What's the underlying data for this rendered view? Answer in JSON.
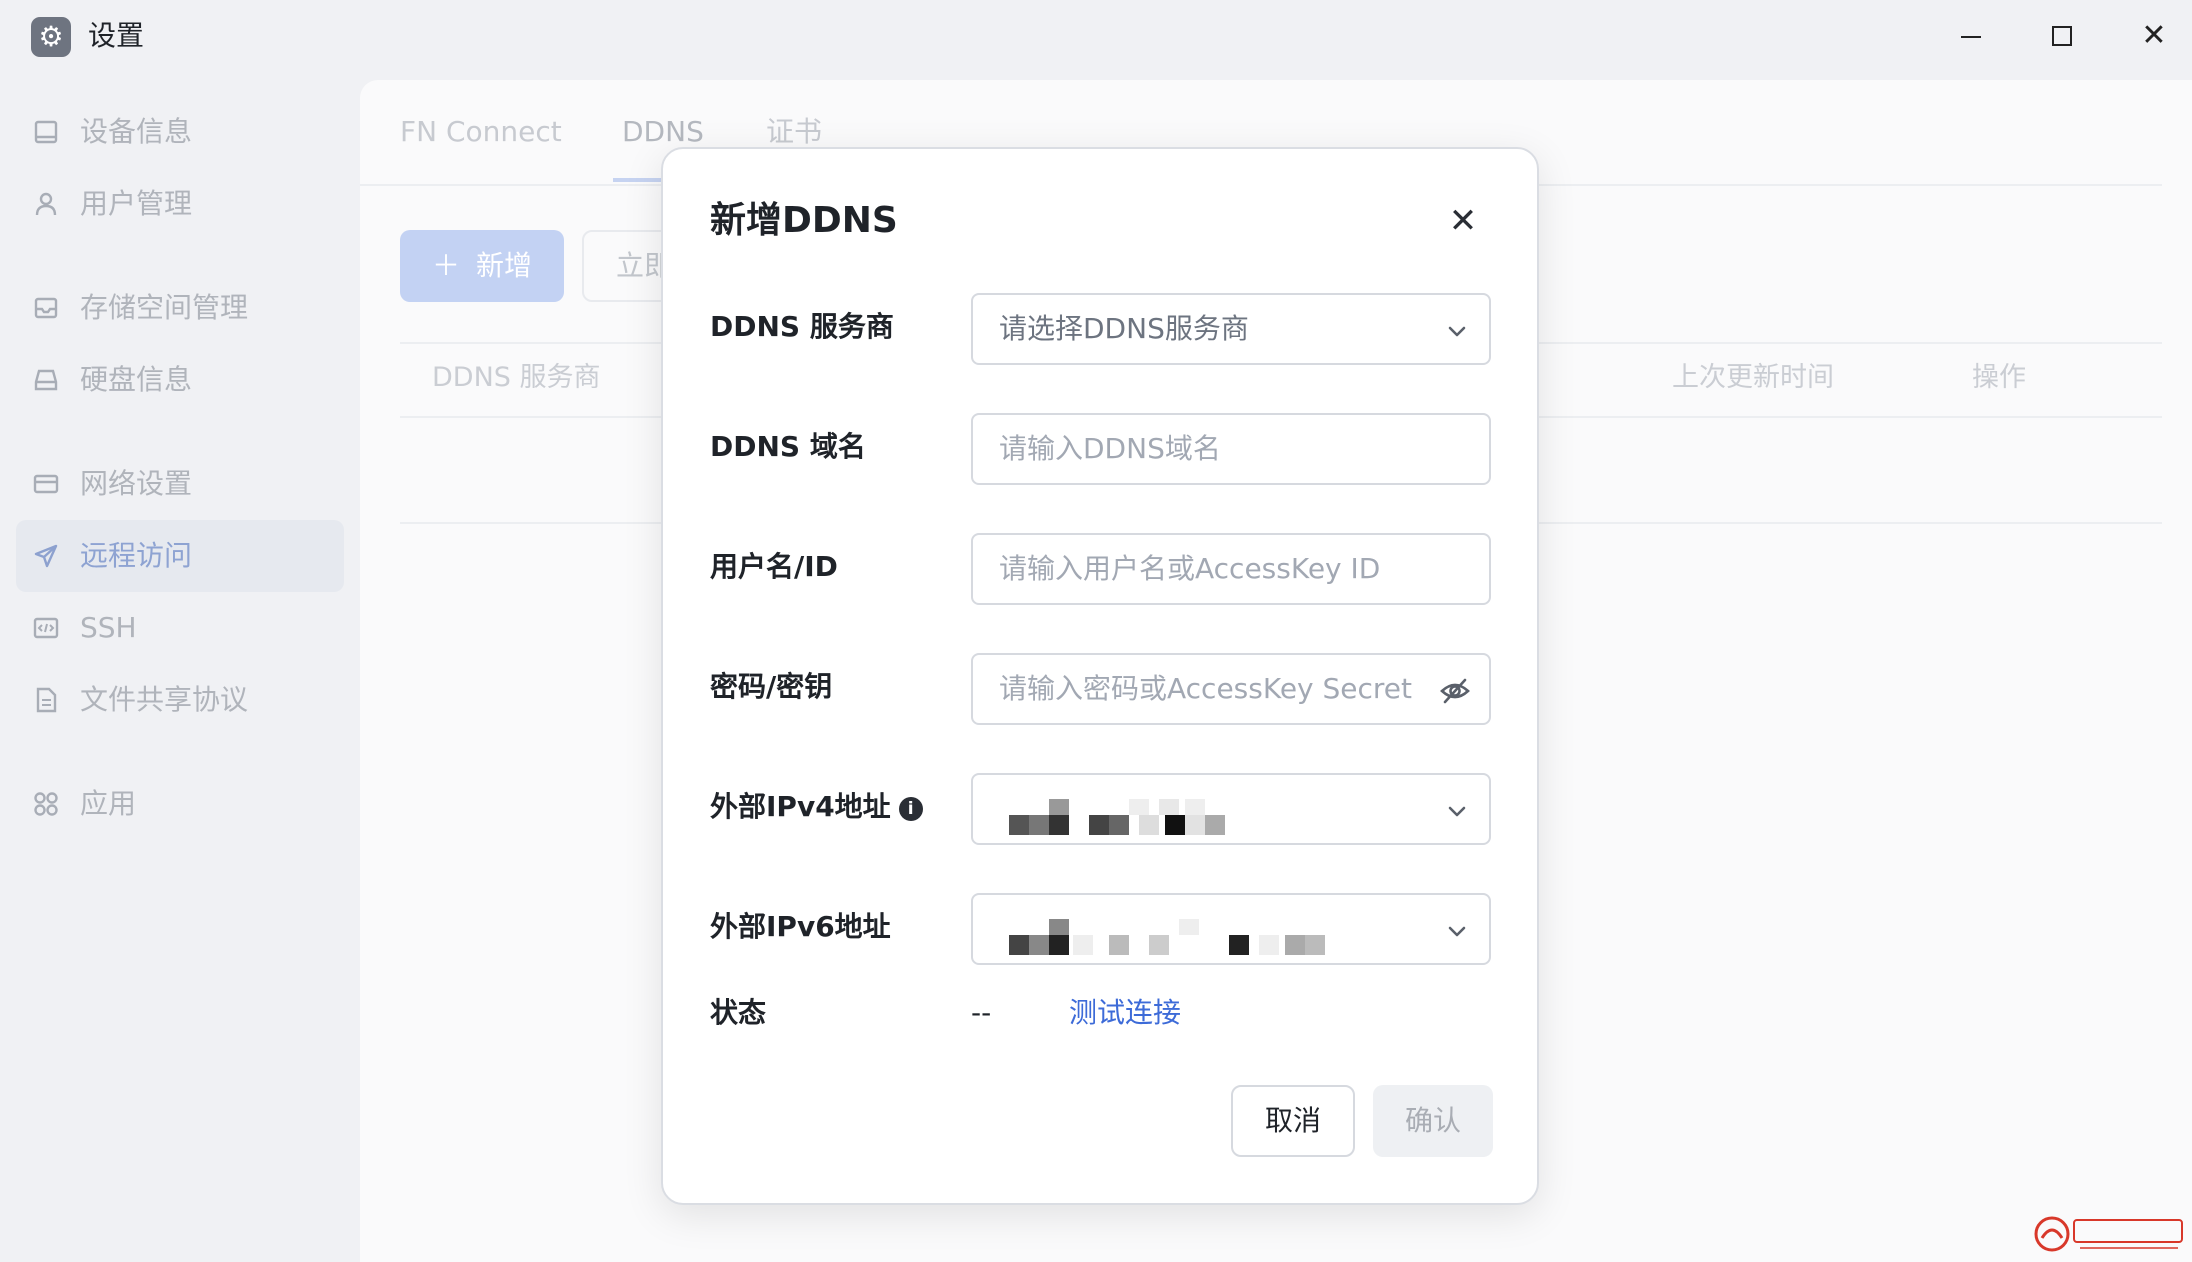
{
  "window": {
    "title": "设置",
    "icons": {
      "app": "gear-icon",
      "minimize": "minimize-icon",
      "maximize": "maximize-icon",
      "close": "close-icon"
    }
  },
  "sidebar": {
    "items": [
      {
        "label": "设备信息",
        "icon": "monitor-icon",
        "active": false
      },
      {
        "label": "用户管理",
        "icon": "user-icon",
        "active": false
      },
      {
        "label": "存储空间管理",
        "icon": "inbox-icon",
        "active": false
      },
      {
        "label": "硬盘信息",
        "icon": "harddisk-icon",
        "active": false
      },
      {
        "label": "网络设置",
        "icon": "network-card-icon",
        "active": false
      },
      {
        "label": "远程访问",
        "icon": "send-icon",
        "active": true
      },
      {
        "label": "SSH",
        "icon": "code-window-icon",
        "active": false
      },
      {
        "label": "文件共享协议",
        "icon": "document-icon",
        "active": false
      },
      {
        "label": "应用",
        "icon": "grid-apps-icon",
        "active": false
      }
    ]
  },
  "main": {
    "tabs": [
      {
        "label": "FN Connect",
        "active": false
      },
      {
        "label": "DDNS",
        "active": true
      },
      {
        "label": "证书",
        "active": false
      }
    ],
    "toolbar": {
      "add_label": "新增",
      "add_icon": "plus-icon",
      "now_label": "立即"
    },
    "table": {
      "headers": [
        "DDNS 服务商",
        "上次更新时间",
        "操作"
      ]
    }
  },
  "modal": {
    "title": "新增DDNS",
    "close_icon": "close-icon",
    "fields": {
      "provider": {
        "label": "DDNS 服务商",
        "placeholder": "请选择DDNS服务商"
      },
      "domain": {
        "label": "DDNS 域名",
        "placeholder": "请输入DDNS域名"
      },
      "username": {
        "label": "用户名/ID",
        "placeholder": "请输入用户名或AccessKey ID"
      },
      "password": {
        "label": "密码/密钥",
        "placeholder": "请输入密码或AccessKey Secret",
        "icon": "eye-off-icon"
      },
      "ipv4": {
        "label": "外部IPv4地址",
        "info_icon": "info-icon",
        "value_state": "pixelated"
      },
      "ipv6": {
        "label": "外部IPv6地址",
        "value_state": "pixelated"
      },
      "status": {
        "label": "状态",
        "value": "--",
        "test_link": "测试连接"
      }
    },
    "buttons": {
      "cancel": "取消",
      "confirm": "确认"
    }
  },
  "colors": {
    "primary_link": "#3d6bd8",
    "disabled_primary": "#c3d2f3",
    "active_nav_text": "#8ea3d2",
    "background": "#f0f1f4"
  }
}
